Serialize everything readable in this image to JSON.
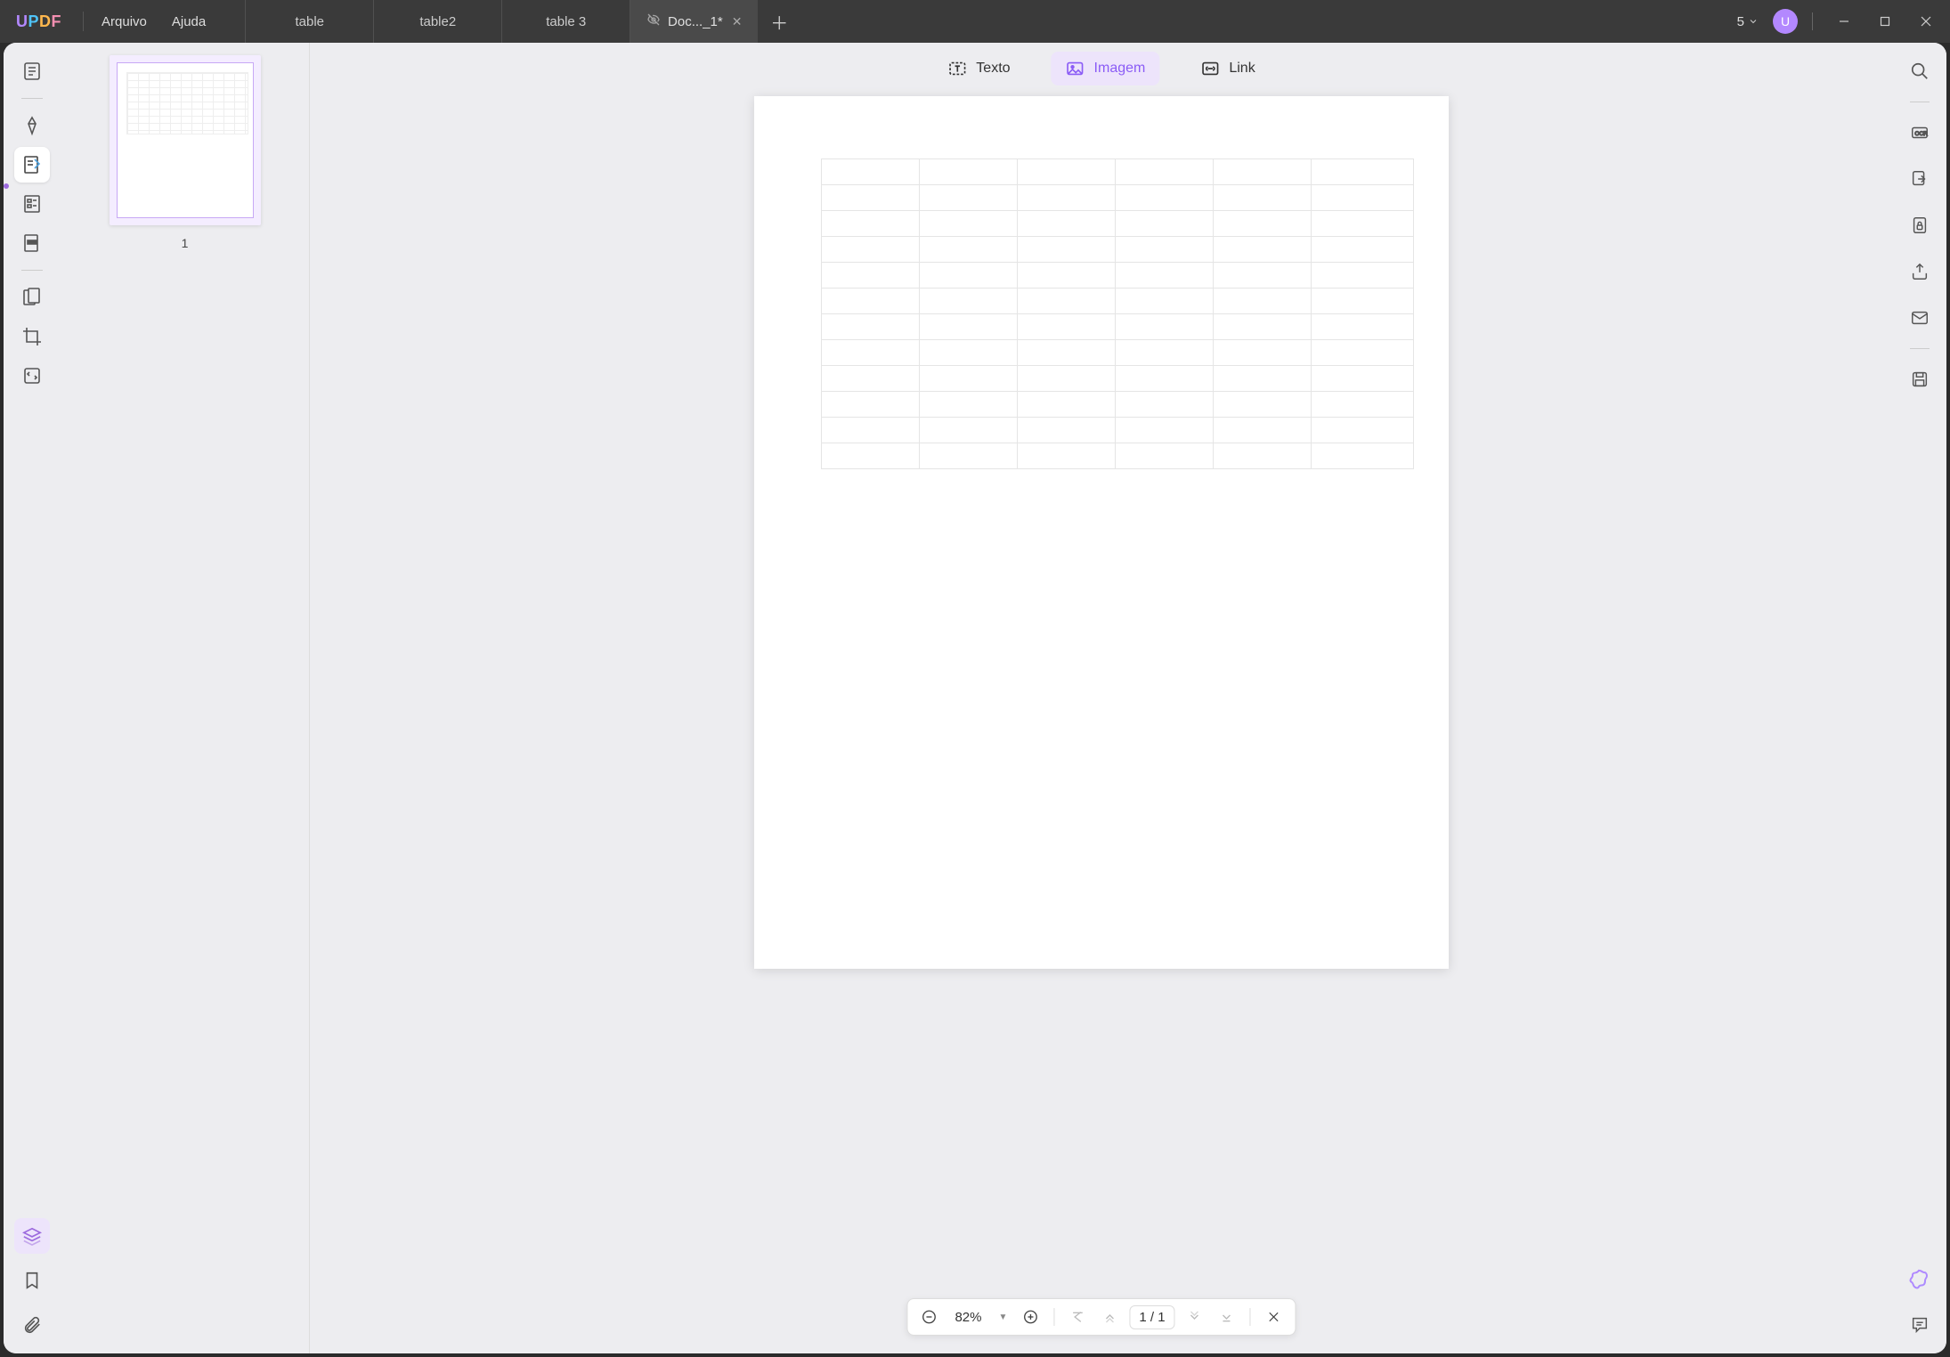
{
  "logo": {
    "text": "UPDF"
  },
  "menu": {
    "file": "Arquivo",
    "help": "Ajuda"
  },
  "tabs": [
    {
      "label": "table"
    },
    {
      "label": "table2"
    },
    {
      "label": "table 3"
    },
    {
      "label": "Doc..._1*",
      "active": true
    }
  ],
  "notifications": {
    "count": "5"
  },
  "avatar": {
    "initial": "U"
  },
  "thumbnails": {
    "page1_label": "1"
  },
  "edit_toolbar": {
    "text": "Texto",
    "image": "Imagem",
    "link": "Link"
  },
  "page_bar": {
    "zoom": "82%",
    "page_display": "1 / 1"
  },
  "colors": {
    "accent": "#9c6ade",
    "accent_light": "#ede4fb"
  }
}
